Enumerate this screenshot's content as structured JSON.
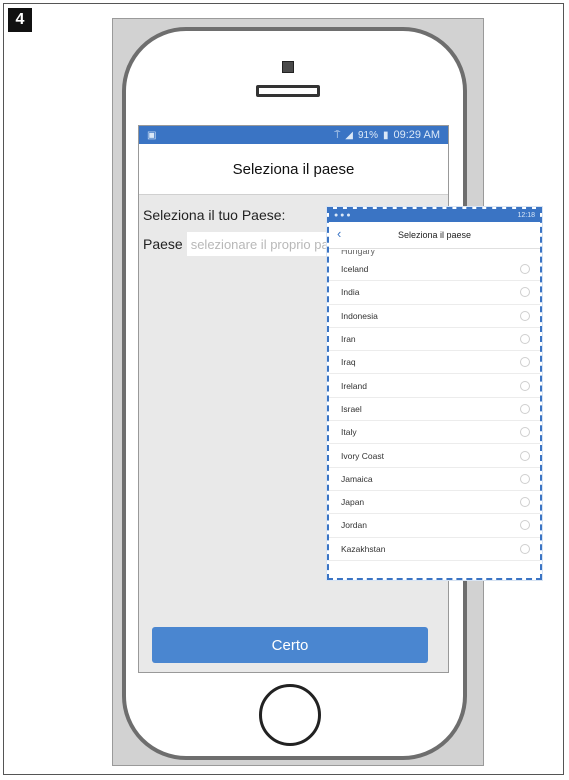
{
  "step": {
    "number": "4"
  },
  "status_bar": {
    "time": "09:29 AM",
    "battery": "91%"
  },
  "screen": {
    "title": "Seleziona il paese",
    "prompt": "Seleziona il tuo Paese:",
    "field_label": "Paese",
    "field_placeholder": "selezionare il proprio paese",
    "ok_button": "Certo"
  },
  "overlay": {
    "status_time": "12:18",
    "title": "Seleziona il paese",
    "partial_item": "Hungary",
    "countries": [
      "Iceland",
      "India",
      "Indonesia",
      "Iran",
      "Iraq",
      "Ireland",
      "Israel",
      "Italy",
      "Ivory Coast",
      "Jamaica",
      "Japan",
      "Jordan",
      "Kazakhstan"
    ]
  },
  "colors": {
    "accent": "#3a74c4",
    "button": "#4a86d0"
  }
}
